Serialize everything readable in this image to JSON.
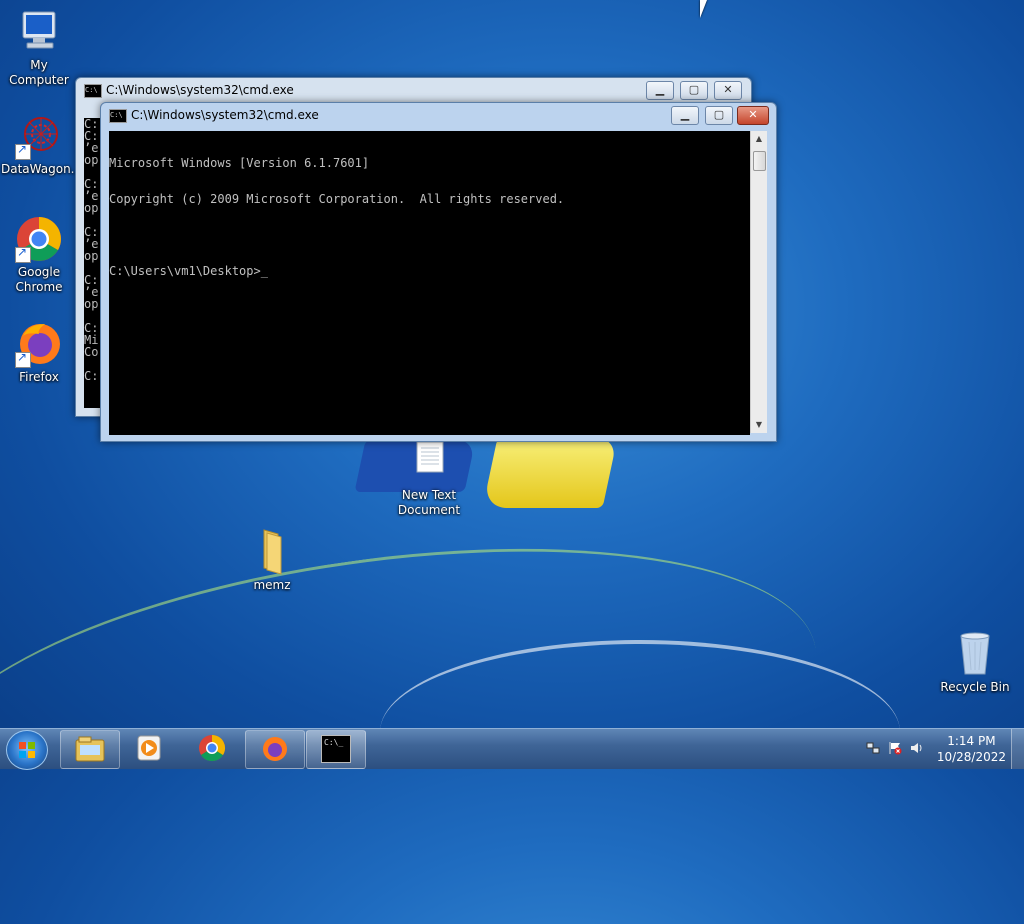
{
  "desktop": {
    "icons": [
      {
        "label": "My Computer",
        "icon": "computer-icon"
      },
      {
        "label": "DataWagon...",
        "icon": "datawagon-icon"
      },
      {
        "label": "Google Chrome",
        "icon": "chrome-icon"
      },
      {
        "label": "Firefox",
        "icon": "firefox-icon"
      },
      {
        "label": "New Text Document",
        "icon": "text-document-icon"
      },
      {
        "label": "memz",
        "icon": "folder-icon"
      },
      {
        "label": "Recycle Bin",
        "icon": "recycle-bin-icon"
      }
    ]
  },
  "back_window": {
    "title": "C:\\Windows\\system32\\cmd.exe",
    "visible_left_text": "C:\nC:\n’e\nop\n\nC:\n’e\nop\n\nC:\n’e\nop\n\nC:\n’e\nop\n\nC:\nMi\nCo\n\nC:"
  },
  "front_window": {
    "title": "C:\\Windows\\system32\\cmd.exe",
    "console_lines": [
      "Microsoft Windows [Version 6.1.7601]",
      "Copyright (c) 2009 Microsoft Corporation.  All rights reserved.",
      "",
      "C:\\Users\\vm1\\Desktop>_"
    ]
  },
  "taskbar": {
    "items": [
      {
        "name": "windows-explorer",
        "icon": "explorer-folder-icon"
      },
      {
        "name": "media-player",
        "icon": "media-player-icon"
      },
      {
        "name": "chrome",
        "icon": "chrome-icon"
      },
      {
        "name": "firefox",
        "icon": "firefox-icon"
      },
      {
        "name": "cmd",
        "icon": "cmd-icon",
        "icon_text": "C:\\_"
      }
    ],
    "clock": {
      "time": "1:14 PM",
      "date": "10/28/2022"
    }
  },
  "colors": {
    "console_bg": "#000000",
    "console_fg": "#c0c0c0",
    "taskbar": "#3f6597",
    "desktop": "#1f6cc0"
  }
}
